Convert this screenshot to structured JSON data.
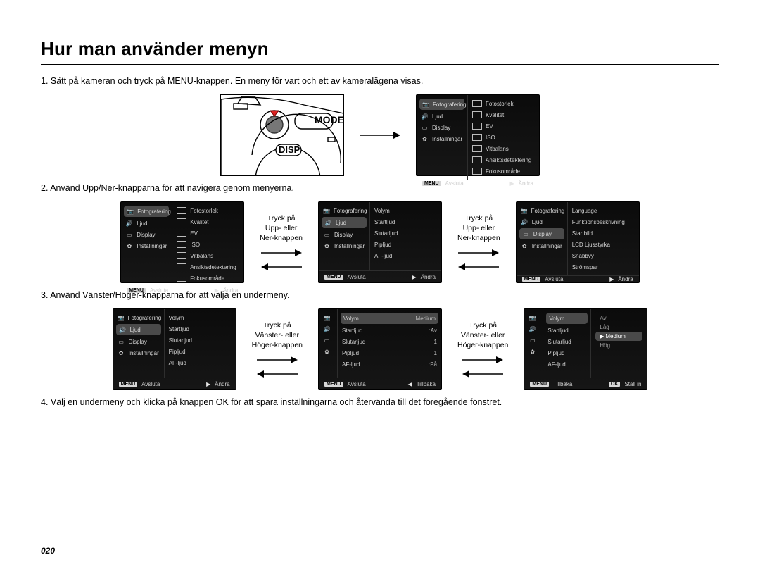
{
  "page": {
    "title": "Hur man använder menyn",
    "number": "020"
  },
  "steps": {
    "s1": "1. Sätt på kameran och tryck på MENU-knappen. En meny för vart och ett av kameralägena visas.",
    "s2": "2. Använd Upp/Ner-knapparna för att navigera genom menyerna.",
    "s3": "3. Använd Vänster/Höger-knapparna för att välja en undermeny.",
    "s4": "4. Välj en undermeny och klicka på knappen OK för att spara inställningarna och återvända till det föregående fönstret."
  },
  "labels": {
    "updown": {
      "l1": "Tryck på",
      "l2": "Upp- eller",
      "l3": "Ner-knappen"
    },
    "leftright": {
      "l1": "Tryck på",
      "l2": "Vänster- eller",
      "l3": "Höger-knappen"
    }
  },
  "footer": {
    "menu": "MENU",
    "exit": "Avsluta",
    "change": "Ändra",
    "back": "Tillbaka",
    "set": "Ställ in",
    "ok": "OK"
  },
  "leftcol": {
    "foto": "Fotografering",
    "ljud": "Ljud",
    "display": "Display",
    "inst": "Inställningar"
  },
  "illus": {
    "mode": "MODE",
    "disp": "DISP"
  },
  "screens": {
    "r1": {
      "items": [
        {
          "k": "Fotostorlek"
        },
        {
          "k": "Kvalitet"
        },
        {
          "k": "EV"
        },
        {
          "k": "ISO"
        },
        {
          "k": "Vitbalans"
        },
        {
          "k": "Ansiktsdetektering"
        },
        {
          "k": "Fokusområde"
        }
      ]
    },
    "r2b": {
      "items": [
        {
          "k": "Volym"
        },
        {
          "k": "Startljud"
        },
        {
          "k": "Slutarljud"
        },
        {
          "k": "Pipljud"
        },
        {
          "k": "AF-ljud"
        }
      ]
    },
    "r2c": {
      "items": [
        {
          "k": "Language"
        },
        {
          "k": "Funktionsbeskrivning"
        },
        {
          "k": "Startbild"
        },
        {
          "k": "LCD Ljusstyrka"
        },
        {
          "k": "Snabbvy"
        },
        {
          "k": "Strömspar"
        }
      ]
    },
    "r3b": {
      "header": "Volym",
      "headerVal": "Medium",
      "items": [
        {
          "k": "Startljud",
          "v": ":Av"
        },
        {
          "k": "Slutarljud",
          "v": ":1"
        },
        {
          "k": "Pipljud",
          "v": ":1"
        },
        {
          "k": "AF-ljud",
          "v": ":På"
        }
      ]
    },
    "r3c": {
      "header": "Volym",
      "dimmed": [
        {
          "k": "Startljud"
        },
        {
          "k": "Slutarljud"
        },
        {
          "k": "Pipljud"
        },
        {
          "k": "AF-ljud"
        }
      ],
      "opts": {
        "o1": "Av",
        "o2": "Låg",
        "o3": "Medium",
        "o4": "Hög"
      }
    }
  }
}
